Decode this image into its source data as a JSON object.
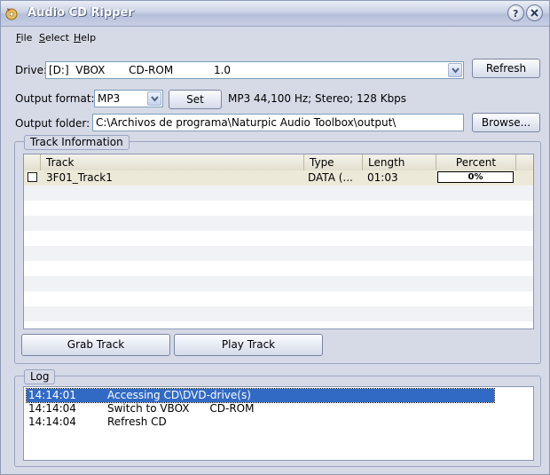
{
  "window": {
    "title": "Audio CD Ripper"
  },
  "menu": [
    {
      "label": "File",
      "accel": "F",
      "rest": "ile"
    },
    {
      "label": "Select",
      "accel": "S",
      "rest": "elect"
    },
    {
      "label": "Help",
      "accel": "H",
      "rest": "elp"
    }
  ],
  "drive": {
    "label": "Drive:",
    "value": "[D:]  VBOX       CD-ROM            1.0",
    "refresh_label": "Refresh"
  },
  "format": {
    "label": "Output format:",
    "value": "MP3",
    "set_label": "Set",
    "info": "MP3 44,100 Hz; Stereo;  128 Kbps"
  },
  "folder": {
    "label": "Output folder:",
    "value": "C:\\Archivos de programa\\Naturpic Audio Toolbox\\output\\",
    "browse_label": "Browse..."
  },
  "track_info": {
    "title": "Track Information",
    "columns": [
      "Track",
      "Type",
      "Length",
      "Percent"
    ],
    "rows": [
      {
        "checked": false,
        "track": "3F01_Track1",
        "type": "DATA (...",
        "length": "01:03",
        "percent": "0%",
        "percent_value": 0
      }
    ]
  },
  "buttons": {
    "grab": "Grab Track",
    "play": "Play Track"
  },
  "log": {
    "title": "Log",
    "entries": [
      {
        "time": "14:14:01",
        "message": "Accessing CD\\DVD-drive(s)",
        "selected": true
      },
      {
        "time": "14:14:04",
        "message": "Switch to VBOX      CD-ROM",
        "selected": false
      },
      {
        "time": "14:14:04",
        "message": "Refresh CD",
        "selected": false
      }
    ]
  }
}
